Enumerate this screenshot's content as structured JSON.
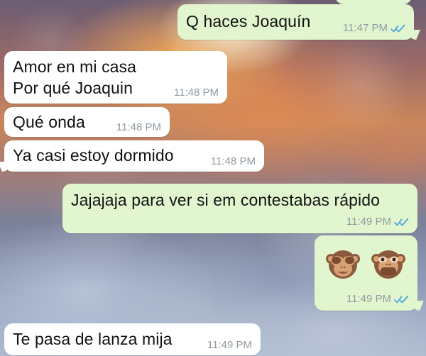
{
  "messages": [
    {
      "id": "m1",
      "direction": "outgoing",
      "text": "Q haces Joaquín",
      "time": "11:47 PM",
      "status_icon": "double-check-icon"
    },
    {
      "id": "m2",
      "direction": "incoming",
      "text": "Amor en mi casa\nPor qué Joaquin",
      "time": "11:48 PM"
    },
    {
      "id": "m3",
      "direction": "incoming",
      "text": "Qué onda",
      "time": "11:48 PM"
    },
    {
      "id": "m4",
      "direction": "incoming",
      "text": "Ya casi estoy dormido",
      "time": "11:48 PM"
    },
    {
      "id": "m5",
      "direction": "outgoing",
      "text": "Jajajaja para ver si em contestabas rápido",
      "time": "11:49 PM",
      "status_icon": "double-check-icon"
    },
    {
      "id": "m6",
      "direction": "outgoing",
      "emojis": [
        "see-no-evil-monkey-emoji",
        "speak-no-evil-monkey-emoji"
      ],
      "time": "11:49 PM",
      "status_icon": "double-check-icon"
    },
    {
      "id": "m7",
      "direction": "incoming",
      "text": "Te pasa de lanza mija",
      "time": "11:49 PM"
    }
  ],
  "colors": {
    "incoming_bubble": "#ffffff",
    "outgoing_bubble": "#e1f6cf",
    "time_text": "#8f9aa2",
    "read_ticks": "#4fa6dd"
  }
}
